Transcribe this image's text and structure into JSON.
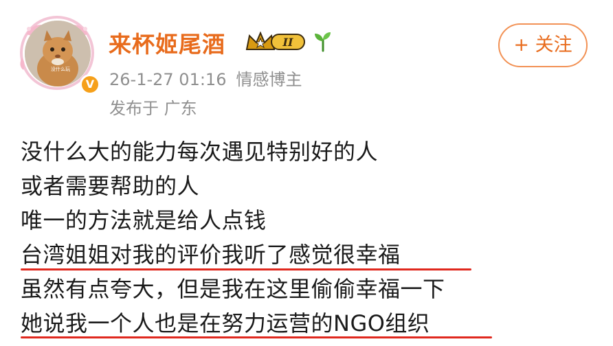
{
  "author": {
    "name": "来杯姬尾酒",
    "avatar_caption": "没什么玩",
    "level_badge": "II",
    "verified_icon": "verified-v-icon",
    "verified_color": "#f6a01a",
    "name_color": "#e86b1c"
  },
  "meta": {
    "timestamp": "26-1-27 01:16",
    "category": "情感博主",
    "location": "发布于 广东"
  },
  "follow_button": {
    "label": "+ 关注"
  },
  "post": {
    "lines": [
      "没什么大的能力每次遇见特别好的人",
      "或者需要帮助的人",
      "唯一的方法就是给人点钱",
      "台湾姐姐对我的评价我听了感觉很幸福",
      "虽然有点夸大，但是我在这里偷偷幸福一下",
      "她说我一个人也是在努力运营的NGO组织"
    ],
    "underlined_lines": [
      3,
      5
    ],
    "underline_color": "#e0281e"
  }
}
